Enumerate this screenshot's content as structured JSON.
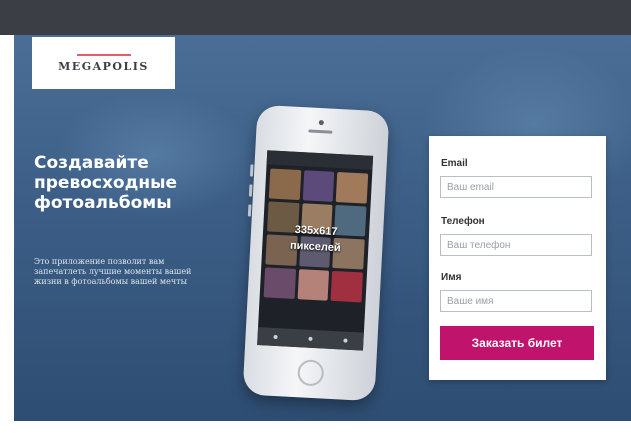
{
  "logo": {
    "text": "MEGAPOLIS"
  },
  "hero": {
    "headline": "Создавайте превосходные фотоальбомы",
    "description": "Это приложение позволит вам запечатлеть лучшие моменты вашей жизни в фотоальбомы вашей мечты"
  },
  "phone": {
    "screen_label_line1": "335x617",
    "screen_label_line2": "пикселей"
  },
  "form": {
    "email_label": "Email",
    "email_placeholder": "Ваш email",
    "phone_label": "Телефон",
    "phone_placeholder": "Ваш телефон",
    "name_label": "Имя",
    "name_placeholder": "Ваше имя",
    "submit_label": "Заказать билет"
  },
  "colors": {
    "topbar": "#3b3f45",
    "hero_bg": "#3c5e86",
    "submit_bg": "#c0136b"
  }
}
